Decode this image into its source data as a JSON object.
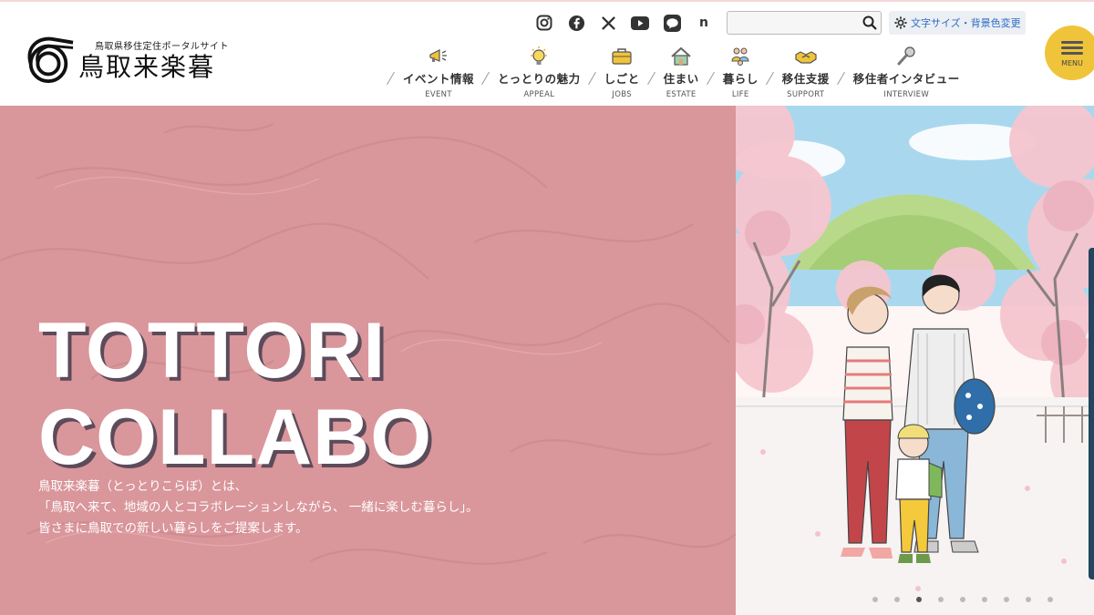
{
  "header": {
    "logo_sub": "鳥取県移住定住ポータルサイト",
    "logo_main": "鳥取来楽暮",
    "social": [
      "instagram-icon",
      "facebook-icon",
      "x-icon",
      "youtube-icon",
      "line-icon",
      "note-icon"
    ],
    "social_note_glyph": "n",
    "search": {
      "value": "",
      "placeholder": ""
    },
    "fontsize_label": "文字サイズ・背景色変更",
    "menu_label": "MENU"
  },
  "nav": [
    {
      "label": "イベント情報",
      "en": "EVENT",
      "icon": "megaphone-icon"
    },
    {
      "label": "とっとりの魅力",
      "en": "APPEAL",
      "icon": "lightbulb-icon"
    },
    {
      "label": "しごと",
      "en": "JOBS",
      "icon": "briefcase-icon"
    },
    {
      "label": "住まい",
      "en": "ESTATE",
      "icon": "house-icon"
    },
    {
      "label": "暮らし",
      "en": "LIFE",
      "icon": "family-icon"
    },
    {
      "label": "移住支援",
      "en": "SUPPORT",
      "icon": "handshake-icon"
    },
    {
      "label": "移住者インタビュー",
      "en": "INTERVIEW",
      "icon": "microphone-icon"
    }
  ],
  "hero": {
    "title_line1": "TOTTORI",
    "title_line2": "COLLABO",
    "copy_line1": "鳥取来楽暮（とっとりこらぼ）とは、",
    "copy_line2": "「鳥取へ来て、地域の人とコラボレーションしながら、 一緒に楽しむ暮らし」。",
    "copy_line3": "皆さまに鳥取での新しい暮らしをご提案します。",
    "slide_count": 9,
    "active_slide": 3
  },
  "colors": {
    "hero_pink": "#d9969b",
    "menu_yellow": "#f0c43a",
    "link_blue": "#2d6cc7",
    "title_shadow": "#5c4b5a"
  }
}
